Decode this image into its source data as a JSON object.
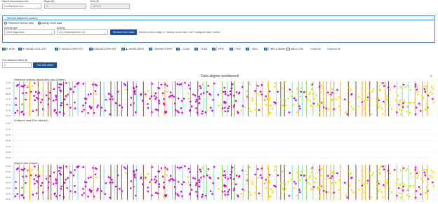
{
  "top_fields": {
    "line_label": "Select transmission line",
    "line_value": "Cumberland Line",
    "begin_label": "Begin (ft)",
    "begin_value": "0",
    "end_label": "End (ft)",
    "end_value": "207474"
  },
  "panel": {
    "title": "− Manual alignment options",
    "radio_reference": "Reference feature data",
    "radio_activity": "Activity result data",
    "activity_type_label": "Activity type",
    "activity_type_value": "Inline Inspection",
    "activity_label": "Activity",
    "activity_value": "ILI Cumberland line u/3",
    "remove_button": "Remove from chart",
    "hint": "Select points to align in \"Activity result data\" and \"Unaligned data\" charts"
  },
  "filters": [
    {
      "label": "AGM",
      "marker": "✕",
      "color": "#333333",
      "checked": true
    },
    {
      "label": "ANOM-COCL-EXT",
      "marker": "▼",
      "color": "#555555",
      "checked": true
    },
    {
      "label": "ANOM-CORR-EXT",
      "marker": "✕",
      "color": "#333333",
      "checked": true
    },
    {
      "label": "ANOM-CORR-INT",
      "marker": "●",
      "color": "#e000e0",
      "checked": true
    },
    {
      "label": "ANOM-DENT",
      "marker": "▲",
      "color": "#222222",
      "checked": true
    },
    {
      "label": "ANOM-OTHER",
      "marker": "●",
      "color": "#e8e800",
      "checked": true
    },
    {
      "label": "CLAM",
      "marker": "│",
      "color": "#00bcd4",
      "checked": true
    },
    {
      "label": "FLAN",
      "marker": "│",
      "color": "#f5a300",
      "checked": true
    },
    {
      "label": "PIPA",
      "marker": "│",
      "color": "#c00000",
      "checked": true
    },
    {
      "label": "TEE",
      "marker": "│",
      "color": "#6a3d1a",
      "checked": true
    },
    {
      "label": "VALV",
      "marker": "│",
      "color": "#7ac943",
      "checked": true
    },
    {
      "label": "WELD-BEND",
      "marker": "│",
      "color": "#5b3a1a",
      "checked": true
    },
    {
      "label": "WELD-GW",
      "marker": "",
      "color": "#333333",
      "checked": false
    }
  ],
  "check_all": "Check all",
  "uncheck_all": "Uncheck all",
  "offset": {
    "label": "Run distance offset (ft)",
    "value": "0",
    "button": "Plot with offset"
  },
  "chart_data": {
    "type": "scatter",
    "title": "Data aligner workbench",
    "subcharts": [
      {
        "name": "Reference features data/Activity data (Station)",
        "ticks": [
          "12.00",
          "10.00",
          "08.00",
          "06.00",
          "04.00",
          "02.00",
          "00.00"
        ],
        "has_data": true
      },
      {
        "name": "Unaligned data (Run distance)",
        "ticks": [
          "12.00",
          "10.00",
          "08.00",
          "06.00",
          "04.00",
          "02.00",
          "00.00"
        ],
        "has_data": false
      },
      {
        "name": "Aligned data (Station)",
        "ticks": [
          "12.00",
          "10.00",
          "08.00",
          "06.00",
          "04.00",
          "02.00",
          "00.00"
        ],
        "has_data": true
      }
    ],
    "series_colors": {
      "corr_int": "#e000e0",
      "other": "#e8e800",
      "clam": "#7fd8e0",
      "flan": "#f5a300",
      "tee": "#6a3d1a",
      "valv": "#7ac943"
    }
  }
}
